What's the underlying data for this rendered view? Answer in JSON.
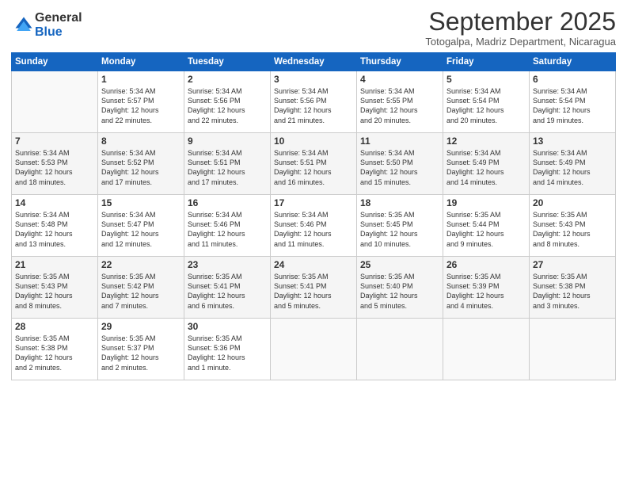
{
  "logo": {
    "general": "General",
    "blue": "Blue"
  },
  "title": "September 2025",
  "subtitle": "Totogalpa, Madriz Department, Nicaragua",
  "headers": [
    "Sunday",
    "Monday",
    "Tuesday",
    "Wednesday",
    "Thursday",
    "Friday",
    "Saturday"
  ],
  "weeks": [
    [
      {
        "day": "",
        "info": ""
      },
      {
        "day": "1",
        "info": "Sunrise: 5:34 AM\nSunset: 5:57 PM\nDaylight: 12 hours\nand 22 minutes."
      },
      {
        "day": "2",
        "info": "Sunrise: 5:34 AM\nSunset: 5:56 PM\nDaylight: 12 hours\nand 22 minutes."
      },
      {
        "day": "3",
        "info": "Sunrise: 5:34 AM\nSunset: 5:56 PM\nDaylight: 12 hours\nand 21 minutes."
      },
      {
        "day": "4",
        "info": "Sunrise: 5:34 AM\nSunset: 5:55 PM\nDaylight: 12 hours\nand 20 minutes."
      },
      {
        "day": "5",
        "info": "Sunrise: 5:34 AM\nSunset: 5:54 PM\nDaylight: 12 hours\nand 20 minutes."
      },
      {
        "day": "6",
        "info": "Sunrise: 5:34 AM\nSunset: 5:54 PM\nDaylight: 12 hours\nand 19 minutes."
      }
    ],
    [
      {
        "day": "7",
        "info": "Sunrise: 5:34 AM\nSunset: 5:53 PM\nDaylight: 12 hours\nand 18 minutes."
      },
      {
        "day": "8",
        "info": "Sunrise: 5:34 AM\nSunset: 5:52 PM\nDaylight: 12 hours\nand 17 minutes."
      },
      {
        "day": "9",
        "info": "Sunrise: 5:34 AM\nSunset: 5:51 PM\nDaylight: 12 hours\nand 17 minutes."
      },
      {
        "day": "10",
        "info": "Sunrise: 5:34 AM\nSunset: 5:51 PM\nDaylight: 12 hours\nand 16 minutes."
      },
      {
        "day": "11",
        "info": "Sunrise: 5:34 AM\nSunset: 5:50 PM\nDaylight: 12 hours\nand 15 minutes."
      },
      {
        "day": "12",
        "info": "Sunrise: 5:34 AM\nSunset: 5:49 PM\nDaylight: 12 hours\nand 14 minutes."
      },
      {
        "day": "13",
        "info": "Sunrise: 5:34 AM\nSunset: 5:49 PM\nDaylight: 12 hours\nand 14 minutes."
      }
    ],
    [
      {
        "day": "14",
        "info": "Sunrise: 5:34 AM\nSunset: 5:48 PM\nDaylight: 12 hours\nand 13 minutes."
      },
      {
        "day": "15",
        "info": "Sunrise: 5:34 AM\nSunset: 5:47 PM\nDaylight: 12 hours\nand 12 minutes."
      },
      {
        "day": "16",
        "info": "Sunrise: 5:34 AM\nSunset: 5:46 PM\nDaylight: 12 hours\nand 11 minutes."
      },
      {
        "day": "17",
        "info": "Sunrise: 5:34 AM\nSunset: 5:46 PM\nDaylight: 12 hours\nand 11 minutes."
      },
      {
        "day": "18",
        "info": "Sunrise: 5:35 AM\nSunset: 5:45 PM\nDaylight: 12 hours\nand 10 minutes."
      },
      {
        "day": "19",
        "info": "Sunrise: 5:35 AM\nSunset: 5:44 PM\nDaylight: 12 hours\nand 9 minutes."
      },
      {
        "day": "20",
        "info": "Sunrise: 5:35 AM\nSunset: 5:43 PM\nDaylight: 12 hours\nand 8 minutes."
      }
    ],
    [
      {
        "day": "21",
        "info": "Sunrise: 5:35 AM\nSunset: 5:43 PM\nDaylight: 12 hours\nand 8 minutes."
      },
      {
        "day": "22",
        "info": "Sunrise: 5:35 AM\nSunset: 5:42 PM\nDaylight: 12 hours\nand 7 minutes."
      },
      {
        "day": "23",
        "info": "Sunrise: 5:35 AM\nSunset: 5:41 PM\nDaylight: 12 hours\nand 6 minutes."
      },
      {
        "day": "24",
        "info": "Sunrise: 5:35 AM\nSunset: 5:41 PM\nDaylight: 12 hours\nand 5 minutes."
      },
      {
        "day": "25",
        "info": "Sunrise: 5:35 AM\nSunset: 5:40 PM\nDaylight: 12 hours\nand 5 minutes."
      },
      {
        "day": "26",
        "info": "Sunrise: 5:35 AM\nSunset: 5:39 PM\nDaylight: 12 hours\nand 4 minutes."
      },
      {
        "day": "27",
        "info": "Sunrise: 5:35 AM\nSunset: 5:38 PM\nDaylight: 12 hours\nand 3 minutes."
      }
    ],
    [
      {
        "day": "28",
        "info": "Sunrise: 5:35 AM\nSunset: 5:38 PM\nDaylight: 12 hours\nand 2 minutes."
      },
      {
        "day": "29",
        "info": "Sunrise: 5:35 AM\nSunset: 5:37 PM\nDaylight: 12 hours\nand 2 minutes."
      },
      {
        "day": "30",
        "info": "Sunrise: 5:35 AM\nSunset: 5:36 PM\nDaylight: 12 hours\nand 1 minute."
      },
      {
        "day": "",
        "info": ""
      },
      {
        "day": "",
        "info": ""
      },
      {
        "day": "",
        "info": ""
      },
      {
        "day": "",
        "info": ""
      }
    ]
  ]
}
